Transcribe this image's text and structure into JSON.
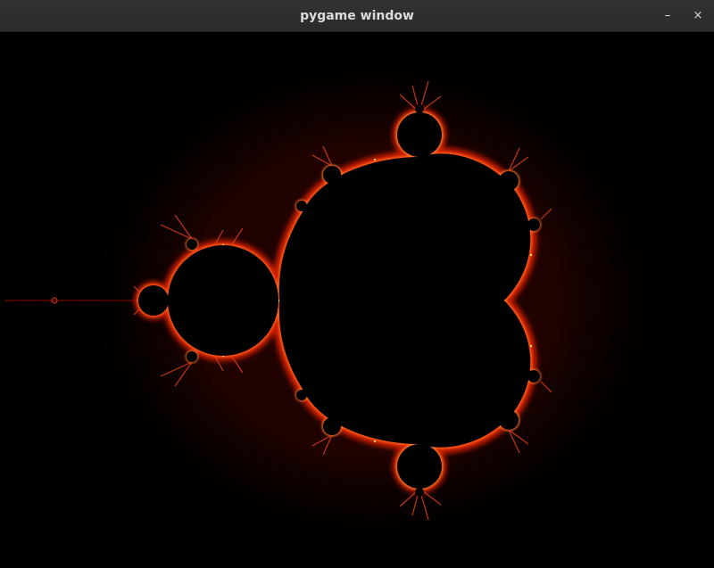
{
  "window": {
    "title": "pygame window",
    "minimize_glyph": "–",
    "close_glyph": "×"
  },
  "icons": {
    "minimize": "minimize-icon",
    "close": "close-icon"
  },
  "colors": {
    "background": "#000000",
    "titlebar": "#2c2e30",
    "fractal_edge_bright": "#ffd35a",
    "fractal_edge_mid": "#ff3a10",
    "fractal_edge_dark": "#6a0a02"
  }
}
